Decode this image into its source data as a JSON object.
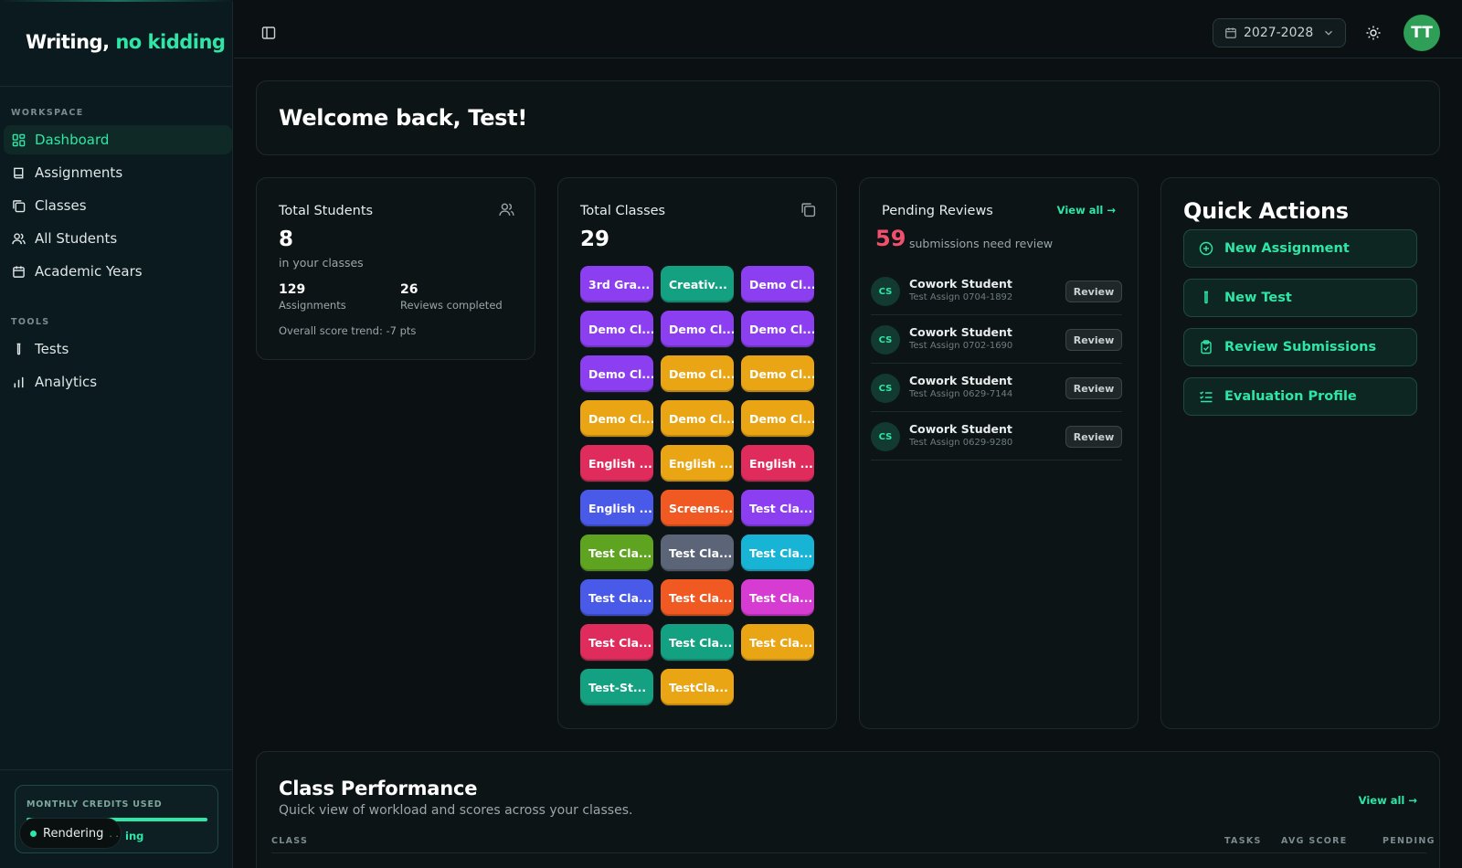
{
  "brand": {
    "name": "Writing,",
    "accent": "no kidding"
  },
  "sidebar": {
    "workspace_label": "WORKSPACE",
    "tools_label": "TOOLS",
    "workspace_items": [
      {
        "label": "Dashboard",
        "icon": "dashboard-icon",
        "active": true
      },
      {
        "label": "Assignments",
        "icon": "book-icon"
      },
      {
        "label": "Classes",
        "icon": "classes-icon"
      },
      {
        "label": "All Students",
        "icon": "users-icon"
      },
      {
        "label": "Academic Years",
        "icon": "calendar-icon"
      }
    ],
    "tool_items": [
      {
        "label": "Tests",
        "icon": "test-tube-icon"
      },
      {
        "label": "Analytics",
        "icon": "bar-chart-icon"
      }
    ],
    "credits": {
      "label": "MONTHLY CREDITS USED",
      "usage_fraction": 1.0,
      "sub": "ing"
    },
    "rendering": {
      "label": "Rendering",
      "dots": ". ."
    }
  },
  "header": {
    "year": "2027-2028",
    "avatar_initials": "TT"
  },
  "welcome": {
    "title": "Welcome back, Test!"
  },
  "total_students": {
    "title": "Total Students",
    "value": "8",
    "sub": "in your classes",
    "assignments_value": "129",
    "assignments_label": "Assignments",
    "reviews_value": "26",
    "reviews_label": "Reviews completed",
    "trend": "Overall score trend: -7 pts"
  },
  "total_classes": {
    "title": "Total Classes",
    "value": "29",
    "chips": [
      {
        "label": "3rd Gra...",
        "color": "#8b3ff0"
      },
      {
        "label": "Creativ...",
        "color": "#14a182"
      },
      {
        "label": "Demo Cl...",
        "color": "#8b3ff0"
      },
      {
        "label": "Demo Cl...",
        "color": "#8b3ff0"
      },
      {
        "label": "Demo Cl...",
        "color": "#8b3ff0"
      },
      {
        "label": "Demo Cl...",
        "color": "#8b3ff0"
      },
      {
        "label": "Demo Cl...",
        "color": "#8b3ff0"
      },
      {
        "label": "Demo Cl...",
        "color": "#eaa514"
      },
      {
        "label": "Demo Cl...",
        "color": "#eaa514"
      },
      {
        "label": "Demo Cl...",
        "color": "#eaa514"
      },
      {
        "label": "Demo Cl...",
        "color": "#eaa514"
      },
      {
        "label": "Demo Cl...",
        "color": "#eaa514"
      },
      {
        "label": "English ...",
        "color": "#e02c5c"
      },
      {
        "label": "English ...",
        "color": "#eaa514"
      },
      {
        "label": "English ...",
        "color": "#e02c5c"
      },
      {
        "label": "English ...",
        "color": "#4a5ae8"
      },
      {
        "label": "Screens...",
        "color": "#f05a22"
      },
      {
        "label": "Test Cla...",
        "color": "#8b3ff0"
      },
      {
        "label": "Test Cla...",
        "color": "#5ea420"
      },
      {
        "label": "Test Cla...",
        "color": "#5b6577"
      },
      {
        "label": "Test Cla...",
        "color": "#18b4d6"
      },
      {
        "label": "Test Cla...",
        "color": "#4a5ae8"
      },
      {
        "label": "Test Cla...",
        "color": "#f05a22"
      },
      {
        "label": "Test Cla...",
        "color": "#d63bd2"
      },
      {
        "label": "Test Cla...",
        "color": "#e02c5c"
      },
      {
        "label": "Test Cla...",
        "color": "#14a182"
      },
      {
        "label": "Test Cla...",
        "color": "#eaa514"
      },
      {
        "label": "Test-St...",
        "color": "#14a182"
      },
      {
        "label": "TestCla...",
        "color": "#eaa514"
      }
    ]
  },
  "pending_reviews": {
    "title": "Pending Reviews",
    "view_all": "View all →",
    "count": "59",
    "count_label": "submissions need review",
    "items": [
      {
        "initials": "CS",
        "name": "Cowork Student",
        "assignment": "Test Assign 0704-1892",
        "action": "Review"
      },
      {
        "initials": "CS",
        "name": "Cowork Student",
        "assignment": "Test Assign 0702-1690",
        "action": "Review"
      },
      {
        "initials": "CS",
        "name": "Cowork Student",
        "assignment": "Test Assign 0629-7144",
        "action": "Review"
      },
      {
        "initials": "CS",
        "name": "Cowork Student",
        "assignment": "Test Assign 0629-9280",
        "action": "Review"
      }
    ]
  },
  "quick_actions": {
    "title": "Quick Actions",
    "buttons": [
      {
        "label": "New Assignment",
        "icon": "plus-circle-icon"
      },
      {
        "label": "New Test",
        "icon": "test-tube-icon"
      },
      {
        "label": "Review Submissions",
        "icon": "clipboard-check-icon"
      },
      {
        "label": "Evaluation Profile",
        "icon": "list-checks-icon"
      }
    ]
  },
  "class_performance": {
    "title": "Class Performance",
    "description": "Quick view of workload and scores across your classes.",
    "view_all": "View all →",
    "columns": [
      "CLASS",
      "TASKS",
      "AVG SCORE",
      "PENDING"
    ]
  },
  "colors": {
    "accent": "#2ee6a6",
    "danger": "#f0506e",
    "background": "#0b1113"
  }
}
